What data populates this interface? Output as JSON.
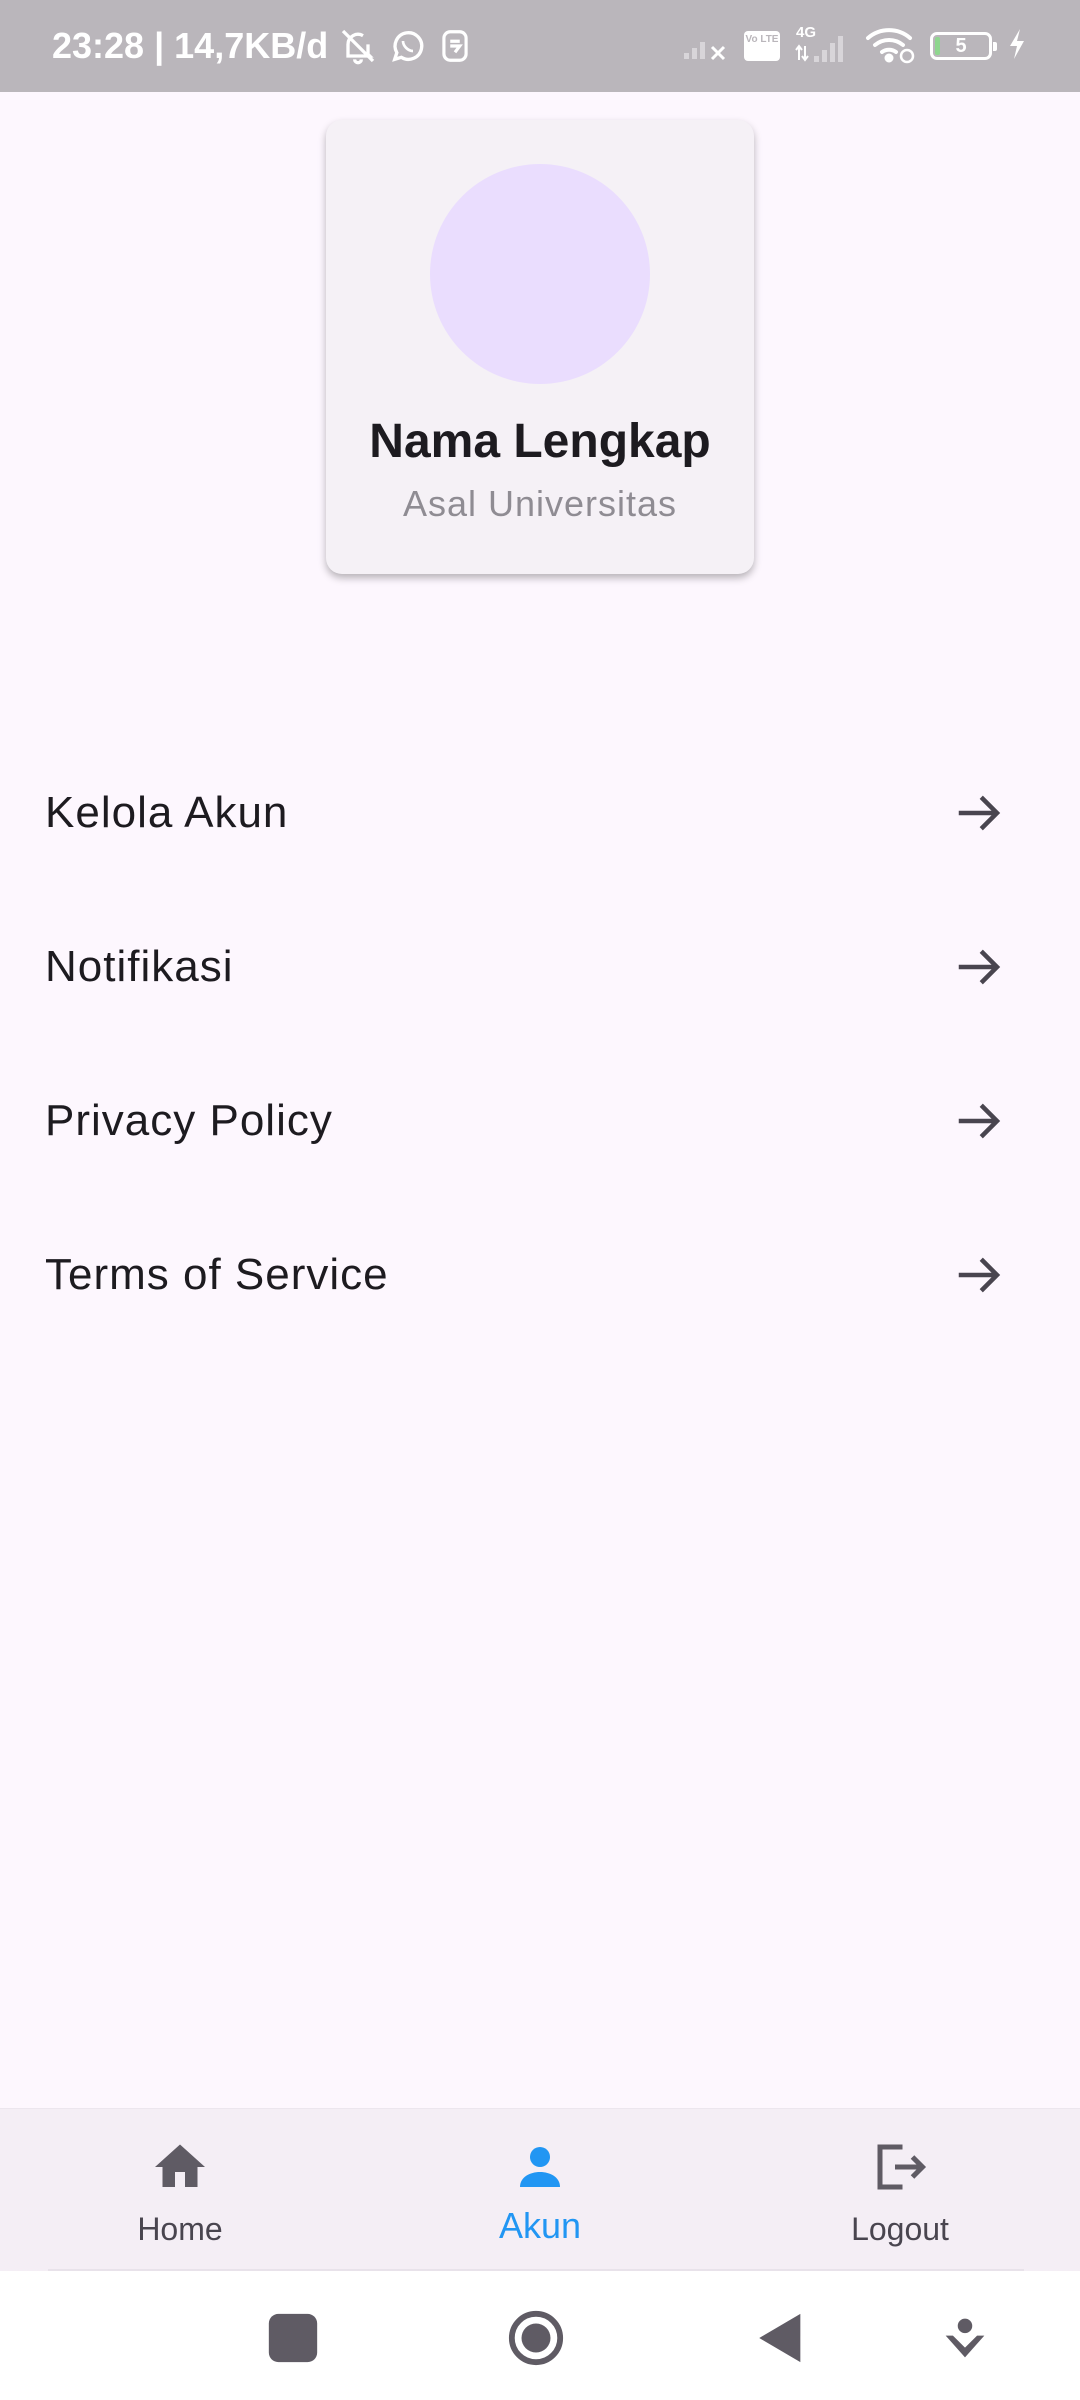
{
  "status_bar": {
    "time_and_speed": "23:28 | 14,7KB/d",
    "network_type": "4G",
    "volte_label": "Vo LTE",
    "battery_level": "5"
  },
  "profile": {
    "name": "Nama Lengkap",
    "university": "Asal Universitas"
  },
  "menu": {
    "items": [
      {
        "label": "Kelola Akun"
      },
      {
        "label": "Notifikasi"
      },
      {
        "label": "Privacy Policy"
      },
      {
        "label": "Terms of Service"
      }
    ]
  },
  "bottom_nav": {
    "items": [
      {
        "label": "Home",
        "icon": "home-icon",
        "active": false
      },
      {
        "label": "Akun",
        "icon": "person-icon",
        "active": true
      },
      {
        "label": "Logout",
        "icon": "logout-icon",
        "active": false
      }
    ],
    "active_color": "#2196f3"
  },
  "colors": {
    "background": "#fdf7fe",
    "avatar": "#eaddfe",
    "status_bar": "#bab6bb"
  }
}
